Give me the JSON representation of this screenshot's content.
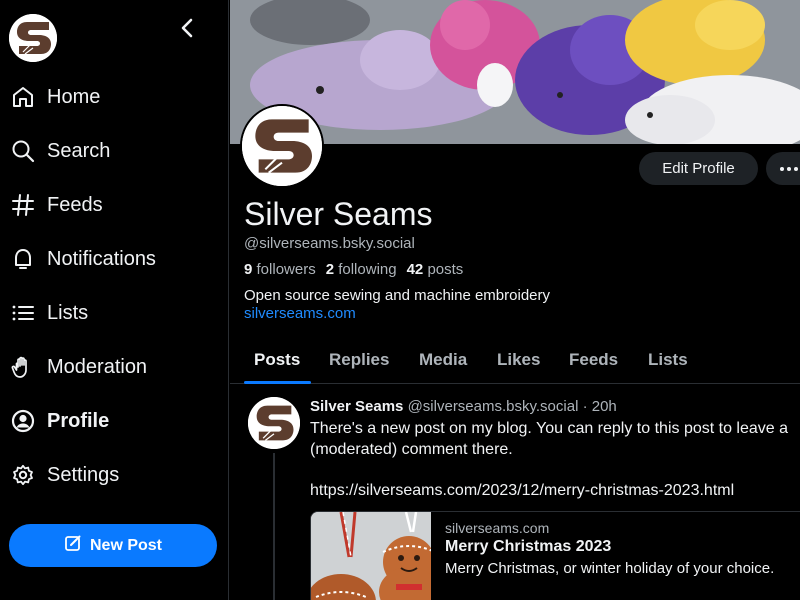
{
  "sidebar": {
    "logo": "silver-seams-logo",
    "collapse_icon": "chevron-left-icon",
    "items": [
      {
        "label": "Home",
        "icon": "home-icon"
      },
      {
        "label": "Search",
        "icon": "search-icon"
      },
      {
        "label": "Feeds",
        "icon": "hash-icon"
      },
      {
        "label": "Notifications",
        "icon": "bell-icon"
      },
      {
        "label": "Lists",
        "icon": "list-icon"
      },
      {
        "label": "Moderation",
        "icon": "hand-icon"
      },
      {
        "label": "Profile",
        "icon": "user-circle-icon",
        "active": true
      },
      {
        "label": "Settings",
        "icon": "gear-icon"
      }
    ],
    "new_post_label": "New Post"
  },
  "profile": {
    "display_name": "Silver Seams",
    "handle": "@silverseams.bsky.social",
    "followers_count": "9",
    "followers_label": "followers",
    "following_count": "2",
    "following_label": "following",
    "posts_count": "42",
    "posts_label": "posts",
    "bio": "Open source sewing and machine embroidery",
    "link": "silverseams.com",
    "edit_label": "Edit Profile"
  },
  "tabs": [
    {
      "label": "Posts",
      "active": true
    },
    {
      "label": "Replies"
    },
    {
      "label": "Media"
    },
    {
      "label": "Likes"
    },
    {
      "label": "Feeds"
    },
    {
      "label": "Lists"
    }
  ],
  "post": {
    "author": "Silver Seams",
    "handle": "@silverseams.bsky.social",
    "separator": "·",
    "time": "20h",
    "text_line1": "There's a new post on my blog. You can reply to this post to leave a",
    "text_line2": "(moderated) comment there.",
    "url": "https://silverseams.com/2023/12/merry-christmas-2023.html",
    "embed": {
      "domain": "silverseams.com",
      "title": "Merry Christmas 2023",
      "description": "Merry Christmas, or winter holiday of your choice."
    }
  },
  "colors": {
    "accent": "#0a7aff",
    "link": "#208bfe",
    "background": "#000000",
    "logo_brown": "#5c3d2e"
  }
}
